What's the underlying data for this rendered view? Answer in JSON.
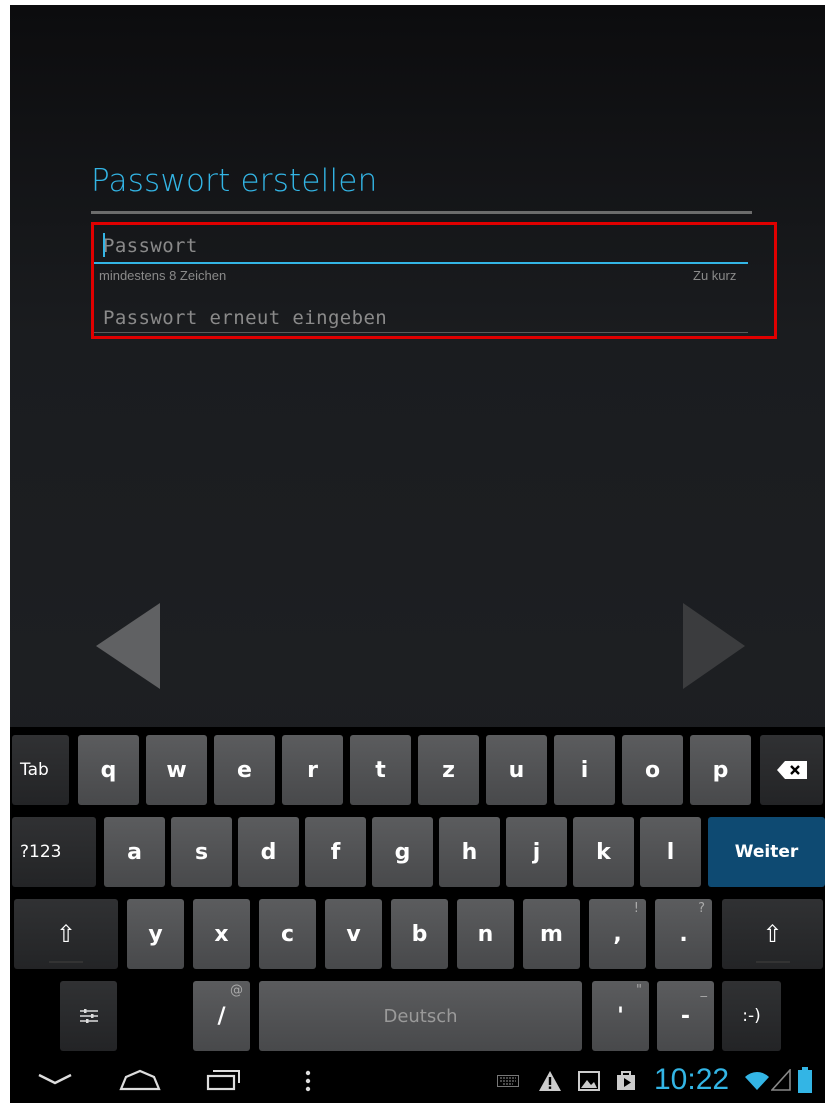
{
  "setup": {
    "title": "Passwort erstellen",
    "password_placeholder": "Passwort",
    "hint": "mindestens 8 Zeichen",
    "strength": "Zu kurz",
    "confirm_placeholder": "Passwort erneut eingeben"
  },
  "keyboard": {
    "row1": [
      "q",
      "w",
      "e",
      "r",
      "t",
      "z",
      "u",
      "i",
      "o",
      "p"
    ],
    "row2": [
      "a",
      "s",
      "d",
      "f",
      "g",
      "h",
      "j",
      "k",
      "l"
    ],
    "row3": [
      "y",
      "x",
      "c",
      "v",
      "b",
      "n",
      "m"
    ],
    "tab_label": "Tab",
    "symbols_label": "?123",
    "enter_label": "Weiter",
    "space_label": "Deutsch",
    "slash_label": "/",
    "slash_alt": "@",
    "comma_label": ",",
    "comma_alt": "!",
    "period_label": ".",
    "period_alt": "?",
    "apostrophe_label": "'",
    "apostrophe_alt": "\"",
    "dash_label": "-",
    "dash_alt": "_",
    "smiley_label": ":-)",
    "shift_icon": "⇧",
    "backspace_icon": "backspace-icon",
    "settings_icon": "keyboard-settings-icon"
  },
  "status_bar": {
    "clock": "10:22",
    "icons": [
      "keyboard-icon",
      "warning-icon",
      "image-icon",
      "shop-icon",
      "wifi-icon",
      "signal-icon",
      "battery-icon"
    ]
  },
  "colors": {
    "accent": "#33b5e5",
    "highlight": "#e00000",
    "enter_key": "#0e4a72"
  }
}
